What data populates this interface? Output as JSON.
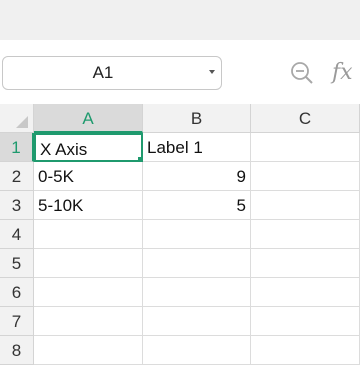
{
  "formula_bar": {
    "name_box": "A1",
    "zoom_icon": "zoom-icon",
    "fx_icon": "fx-icon",
    "fx_label": "fx",
    "accent_color": "#1f9a6e"
  },
  "grid": {
    "columns": [
      "A",
      "B",
      "C"
    ],
    "rows": [
      "1",
      "2",
      "3",
      "4",
      "5",
      "6",
      "7",
      "8"
    ],
    "selected_cell": "A1",
    "cells": {
      "A1": "X Axis",
      "B1": "Label 1",
      "A2": "0-5K",
      "B2": "9",
      "A3": "5-10K",
      "B3": "5"
    }
  }
}
